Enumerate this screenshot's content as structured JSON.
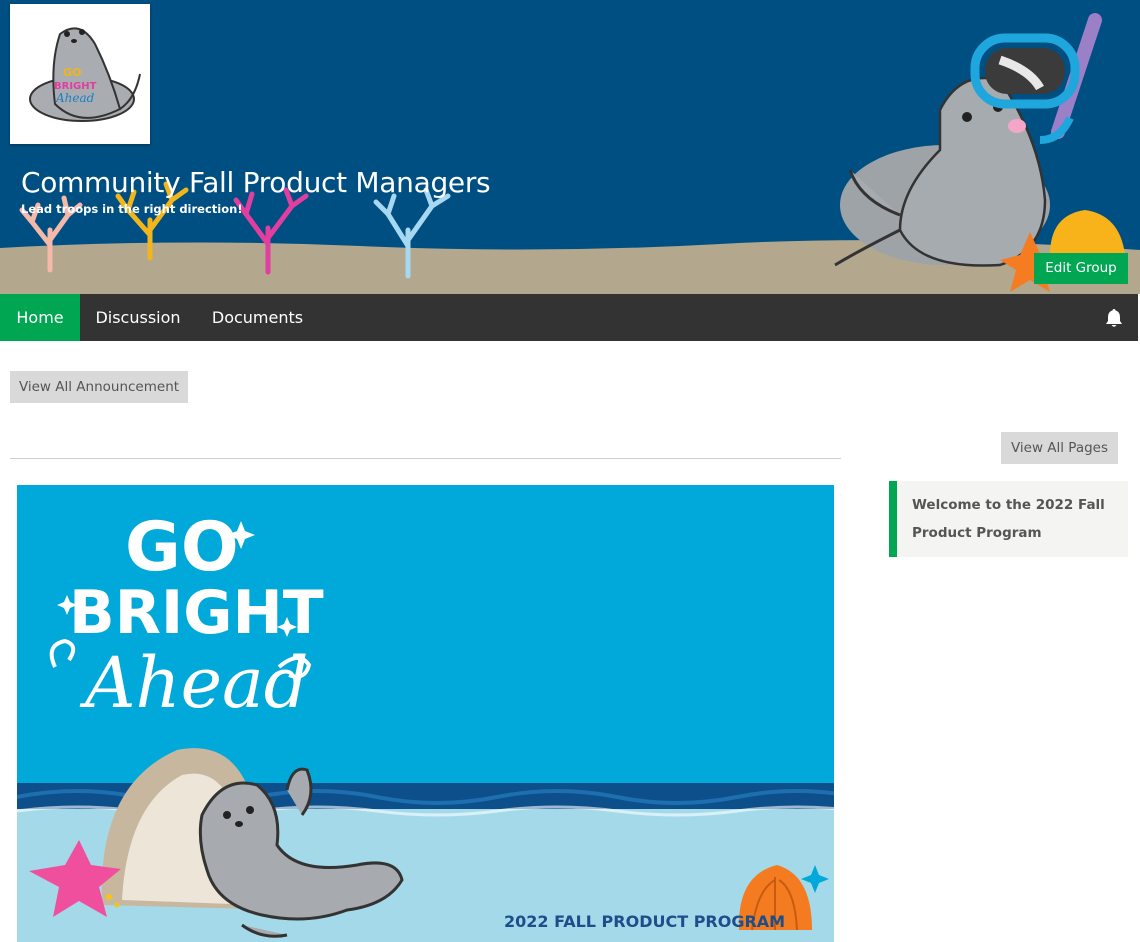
{
  "banner": {
    "title": "Community Fall Product Managers",
    "tagline": "Lead troops in the right direction!",
    "edit_label": "Edit Group",
    "logo": {
      "line1": "GO",
      "line2": "BRIGHT",
      "line3": "Ahead"
    }
  },
  "nav": {
    "items": [
      {
        "label": "Home",
        "active": true
      },
      {
        "label": "Discussion",
        "active": false
      },
      {
        "label": "Documents",
        "active": false
      }
    ],
    "bell_icon": "bell-icon"
  },
  "announcements": {
    "view_all_label": "View All Announcement"
  },
  "pages": {
    "view_all_label": "View All Pages",
    "items": [
      {
        "title": "Welcome to the 2022 Fall Product Program"
      }
    ]
  },
  "feature_image": {
    "line1": "GO",
    "line2": "BRIGHT",
    "line3": "Ahead",
    "caption": "2022 FALL PRODUCT PROGRAM"
  },
  "colors": {
    "accent": "#00a651",
    "banner_bg": "#004f82",
    "nav_bg": "#333333",
    "feature_sky": "#00a9d9"
  }
}
